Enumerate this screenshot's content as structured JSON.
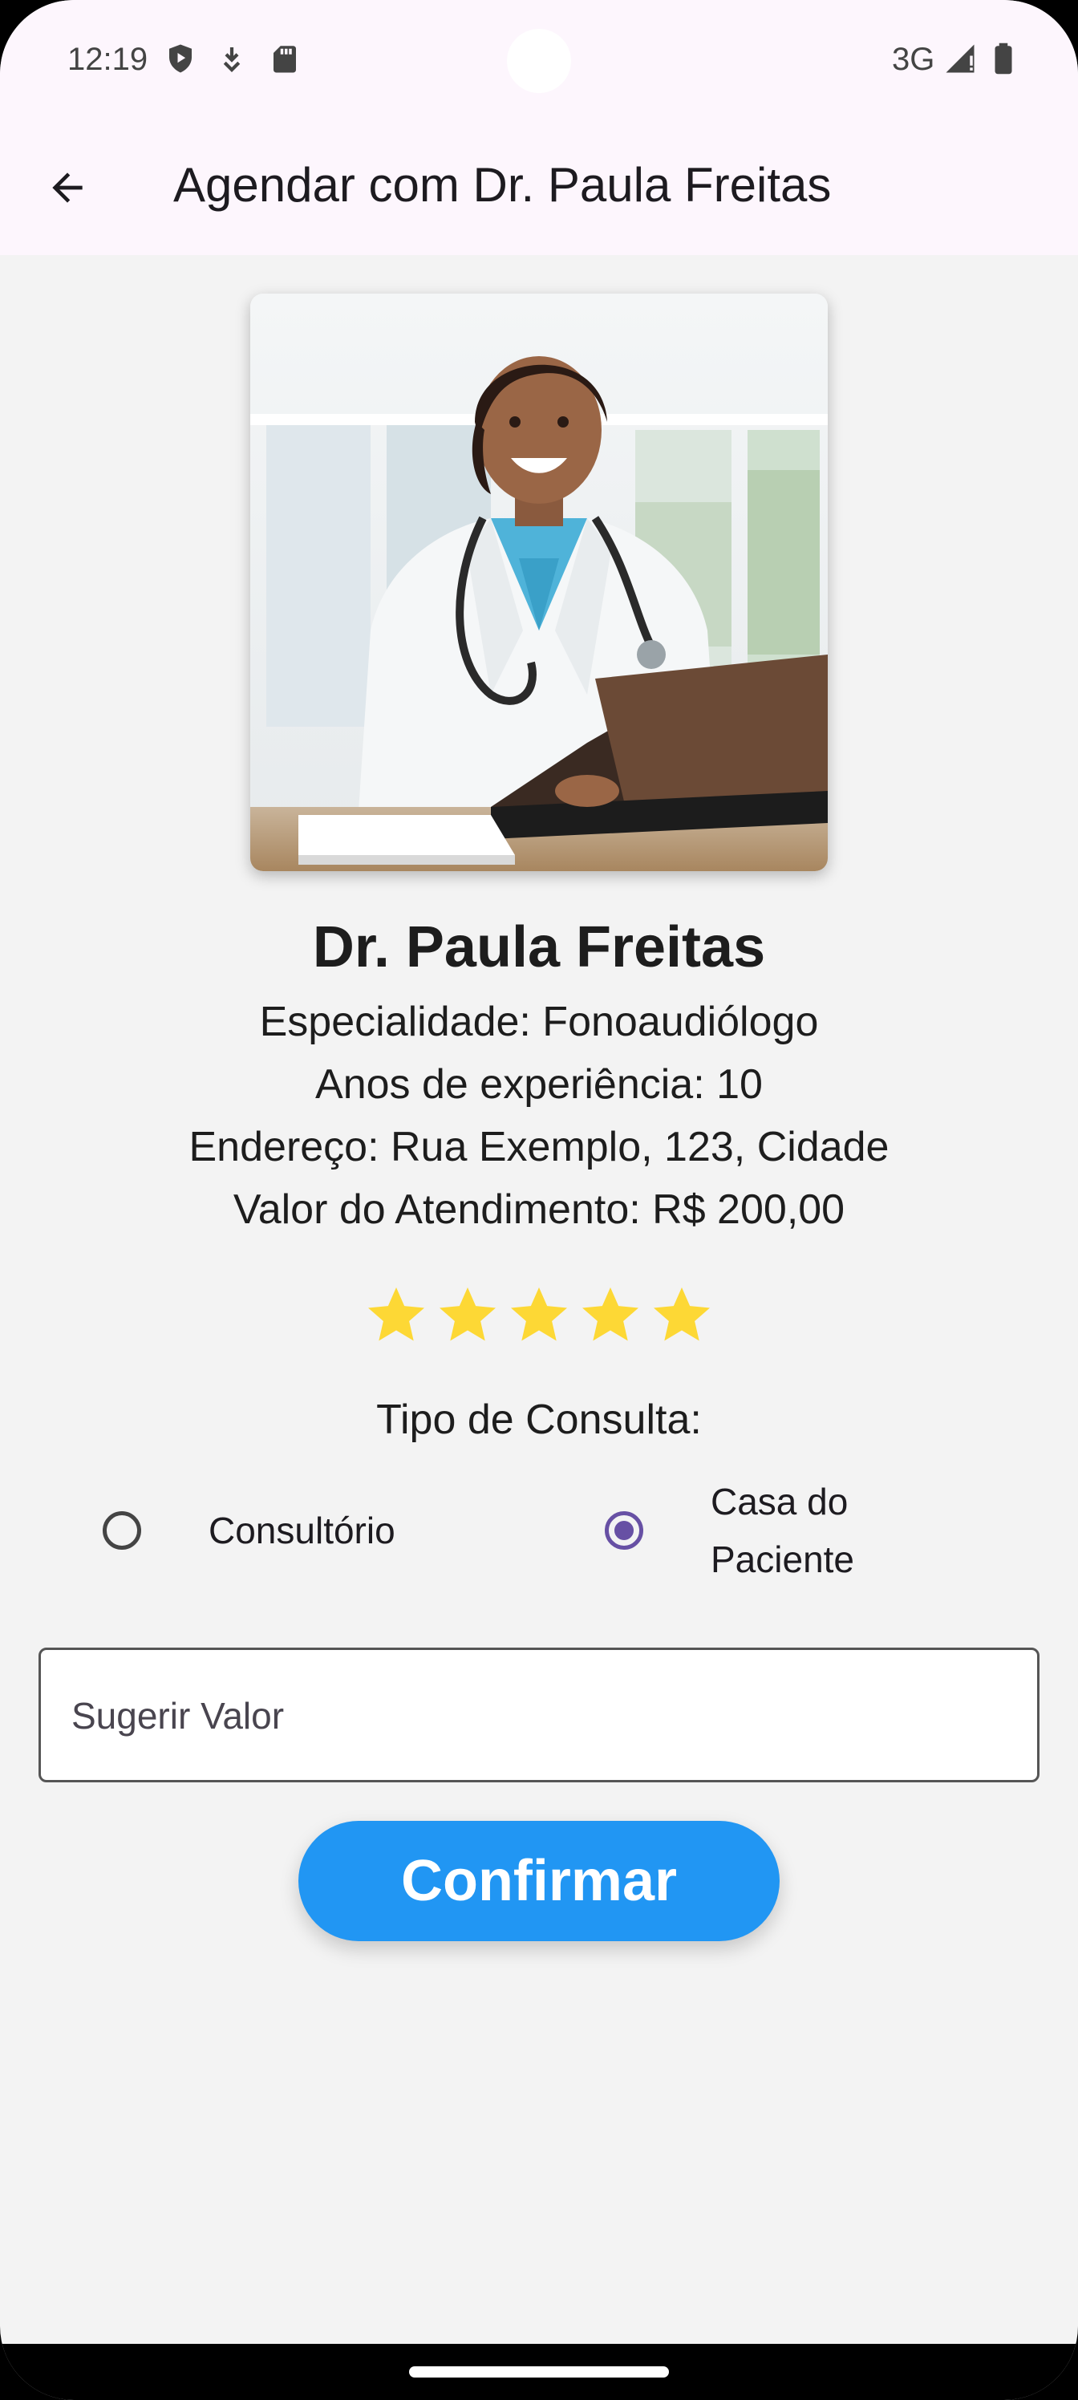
{
  "status_bar": {
    "time": "12:19",
    "network": "3G",
    "icons": [
      "play-protect-icon",
      "download-icon",
      "sd-card-icon",
      "signal-icon",
      "battery-icon"
    ]
  },
  "app_bar": {
    "title": "Agendar com Dr. Paula Freitas",
    "back_icon": "arrow-back-icon"
  },
  "doctor": {
    "name": "Dr. Paula Freitas",
    "specialty": "Especialidade: Fonoaudiólogo",
    "experience": "Anos de experiência: 10",
    "address": "Endereço: Rua Exemplo, 123, Cidade",
    "price": "Valor do Atendimento: R$ 200,00",
    "rating": 5,
    "rating_max": 5
  },
  "consult_type": {
    "label": "Tipo de Consulta:",
    "options": [
      {
        "label": "Consultório",
        "selected": false
      },
      {
        "label_line1": "Casa do",
        "label_line2": "Paciente",
        "selected": true
      }
    ]
  },
  "suggest_value": {
    "placeholder": "Sugerir Valor",
    "value": ""
  },
  "confirm": {
    "label": "Confirmar"
  },
  "colors": {
    "accent": "#2196f3",
    "radio_selected": "#6750a4",
    "star": "#fdd835",
    "app_bar_bg": "#fdf6fd",
    "page_bg": "#f3f3f3"
  }
}
